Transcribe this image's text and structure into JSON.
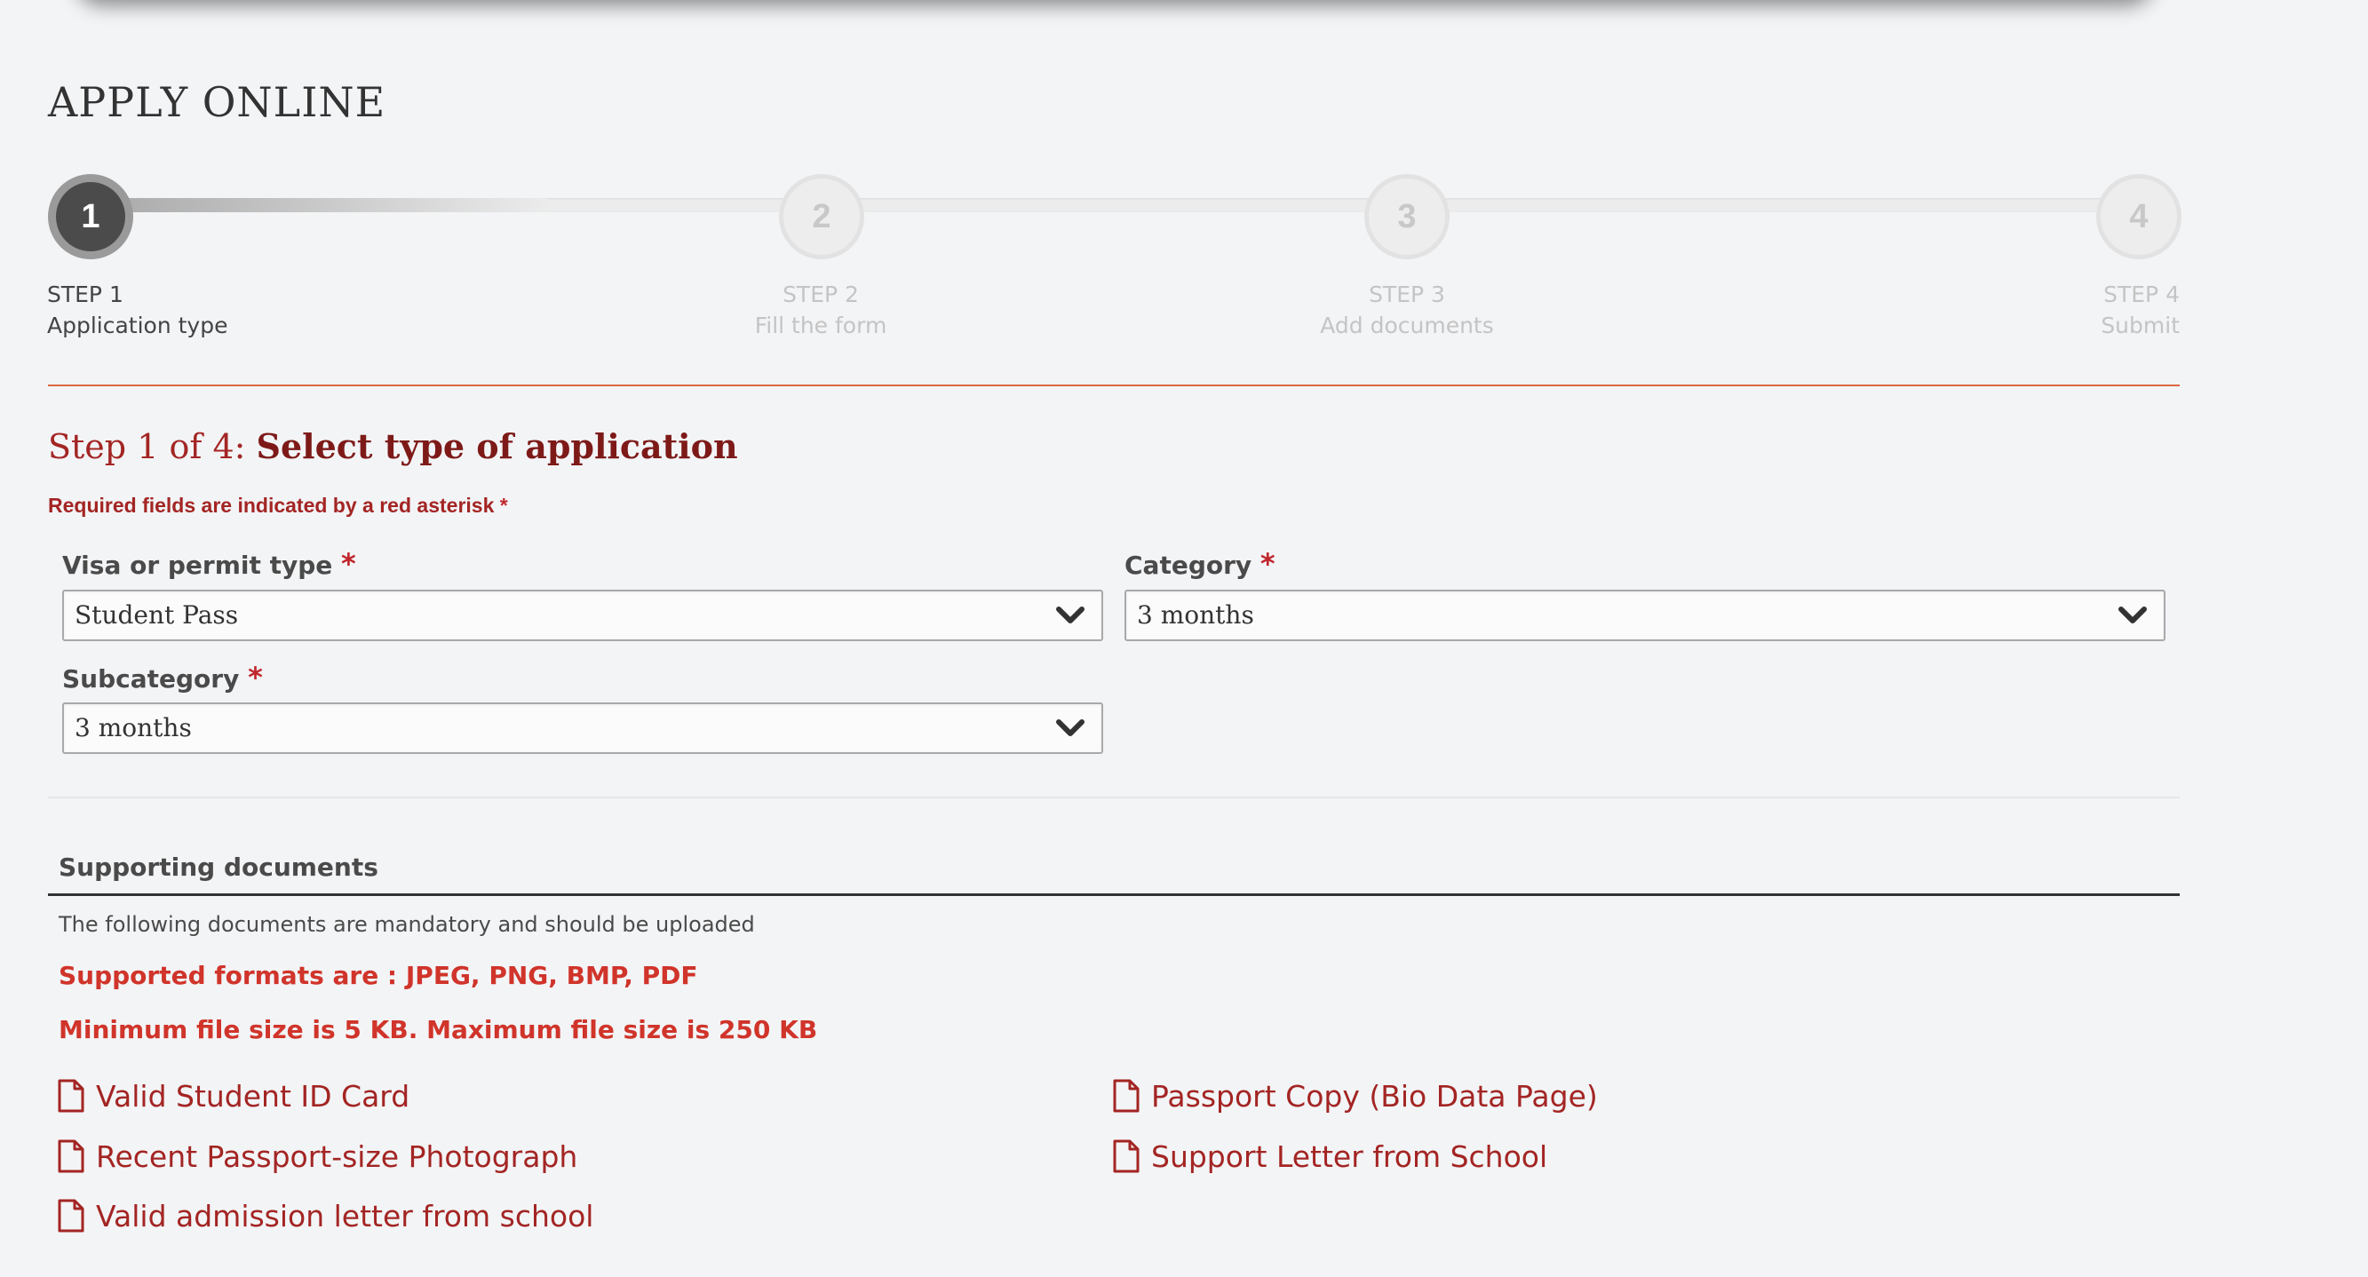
{
  "page": {
    "title": "APPLY ONLINE"
  },
  "steps": [
    {
      "number": "1",
      "step_label": "STEP 1",
      "name": "Application type",
      "state": "active"
    },
    {
      "number": "2",
      "step_label": "STEP 2",
      "name": "Fill the form",
      "state": "inactive"
    },
    {
      "number": "3",
      "step_label": "STEP 3",
      "name": "Add documents",
      "state": "inactive"
    },
    {
      "number": "4",
      "step_label": "STEP 4",
      "name": "Submit",
      "state": "inactive"
    }
  ],
  "heading": {
    "prefix": "Step 1 of 4:",
    "title": "Select type of application"
  },
  "required_note": {
    "text": "Required fields are indicated by a red asterisk",
    "asterisk": "*"
  },
  "form": {
    "visa_type": {
      "label": "Visa or permit type",
      "asterisk": "*",
      "value": "Student Pass"
    },
    "category": {
      "label": "Category",
      "asterisk": "*",
      "value": "3 months"
    },
    "subcategory": {
      "label": "Subcategory",
      "asterisk": "*",
      "value": "3 months"
    }
  },
  "supporting": {
    "title": "Supporting documents",
    "mandatory_note": "The following documents are mandatory and should be uploaded",
    "formats_note": "Supported formats are : JPEG, PNG, BMP, PDF",
    "size_note": "Minimum file size is 5 KB. Maximum file size is 250 KB",
    "documents": [
      {
        "label": "Valid Student ID Card",
        "icon": "file-icon"
      },
      {
        "label": "Passport Copy (Bio Data Page)",
        "icon": "file-icon"
      },
      {
        "label": "Recent Passport-size Photograph",
        "icon": "file-icon"
      },
      {
        "label": "Support Letter from School",
        "icon": "file-icon"
      },
      {
        "label": "Valid admission letter from school",
        "icon": "file-icon"
      }
    ]
  },
  "colors": {
    "accent_red": "#a32523",
    "dark_red": "#7d1a18",
    "alert_red": "#d0342a",
    "divider_orange": "#d9683f",
    "active_step": "#4b4b4b",
    "background": "#f3f4f6"
  }
}
